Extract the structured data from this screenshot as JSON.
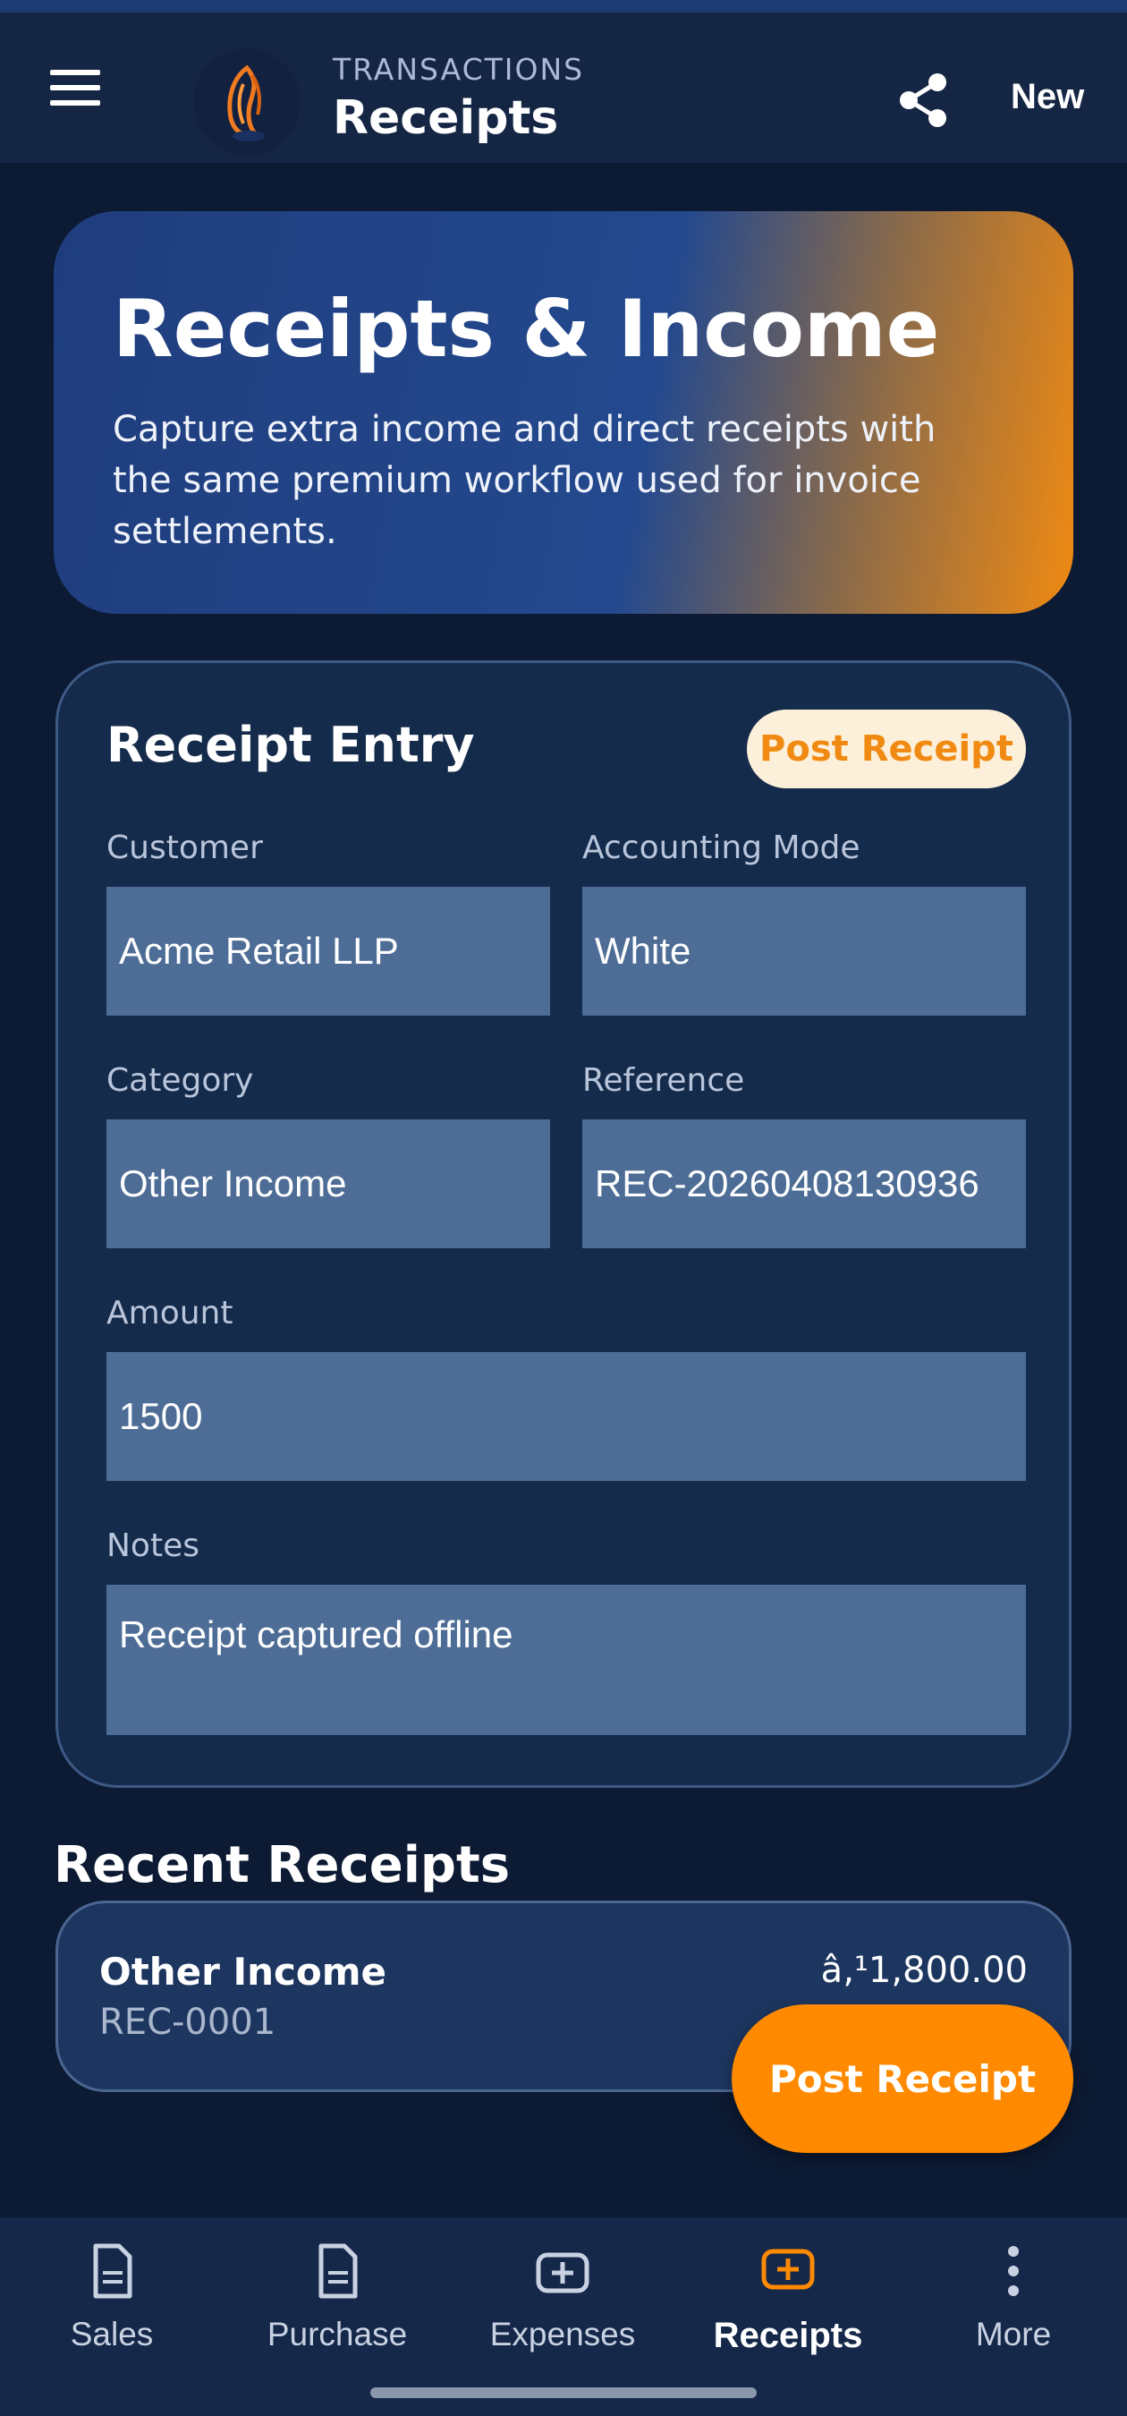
{
  "colors": {
    "background": "#0c1a33",
    "topbar": "#152645",
    "accent_orange": "#ff8a00",
    "hero_blue": "#24498e",
    "card": "#152b4c",
    "input": "#4d6d96"
  },
  "header": {
    "eyebrow": "TRANSACTIONS",
    "title": "Receipts",
    "new_label": "New",
    "menu_icon": "hamburger-menu-icon",
    "logo": "conch-shell-logo",
    "share_icon": "share-icon"
  },
  "hero": {
    "title": "Receipts & Income",
    "description": "Capture extra income and direct receipts with the same premium workflow used for invoice settlements."
  },
  "entry": {
    "title": "Receipt Entry",
    "post_label": "Post Receipt",
    "customer_label": "Customer",
    "customer_value": "Acme Retail LLP",
    "mode_label": "Accounting Mode",
    "mode_value": "White",
    "category_label": "Category",
    "category_value": "Other Income",
    "reference_label": "Reference",
    "reference_value": "REC-20260408130936",
    "amount_label": "Amount",
    "amount_value": "1500",
    "notes_label": "Notes",
    "notes_value": "Receipt captured offline"
  },
  "recent": {
    "title": "Recent Receipts",
    "items": [
      {
        "name": "Other Income",
        "ref": "REC-0001",
        "amount": "â‚¹1,800.00"
      }
    ]
  },
  "fab": {
    "label": "Post Receipt"
  },
  "nav": {
    "items": [
      {
        "label": "Sales",
        "icon": "document-icon"
      },
      {
        "label": "Purchase",
        "icon": "document-icon"
      },
      {
        "label": "Expenses",
        "icon": "add-box-icon"
      },
      {
        "label": "Receipts",
        "icon": "add-box-icon",
        "active": true
      },
      {
        "label": "More",
        "icon": "more-vertical-icon"
      }
    ]
  }
}
